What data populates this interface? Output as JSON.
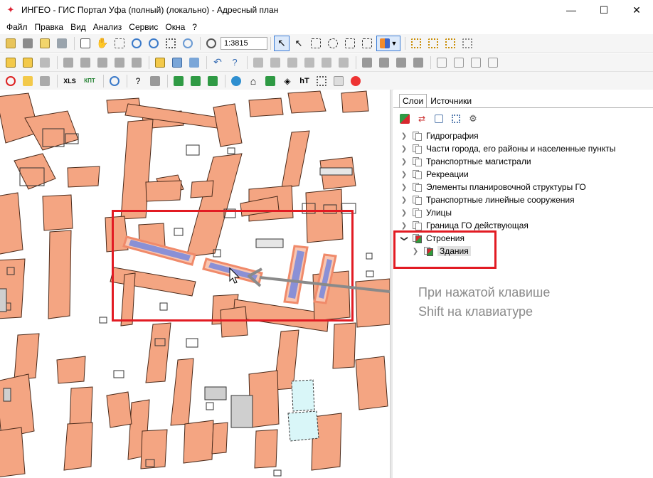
{
  "window": {
    "title": "ИНГЕО - ГИС Портал Уфа (полный) (локально) - Адресный план",
    "minimize_glyph": "—",
    "maximize_glyph": "☐",
    "close_glyph": "✕"
  },
  "menu": [
    "Файл",
    "Правка",
    "Вид",
    "Анализ",
    "Сервис",
    "Окна",
    "?"
  ],
  "toolbar": {
    "scale": "1:3815",
    "xls_label": "XLS",
    "kpt_label": "КПТ"
  },
  "panel": {
    "tabs": [
      "Слои",
      "Источники"
    ],
    "layers": [
      {
        "label": "Гидрография",
        "expanded": false
      },
      {
        "label": "Части города, его районы и населенные пункты",
        "expanded": false
      },
      {
        "label": "Транспортные магистрали",
        "expanded": false
      },
      {
        "label": "Рекреации",
        "expanded": false
      },
      {
        "label": "Элементы планировочной структуры ГО",
        "expanded": false
      },
      {
        "label": "Транспортные линейные сооружения",
        "expanded": false
      },
      {
        "label": "Улицы",
        "expanded": false
      },
      {
        "label": "Граница ГО действующая",
        "expanded": false
      },
      {
        "label": "Строения",
        "expanded": true
      },
      {
        "label": "Здания",
        "expanded": false,
        "child": true,
        "selected": true
      }
    ]
  },
  "annotation": {
    "line1": "При нажатой клавише",
    "line2": "Shift на клавиатуре"
  },
  "colors": {
    "building_fill": "#f4a582",
    "building_stroke": "#4a2a1a",
    "selected_fill": "#8a90d6",
    "selected_halo": "#f08a6a",
    "highlight_red": "#e21b23",
    "arrow_gray": "#8a8a8a"
  }
}
